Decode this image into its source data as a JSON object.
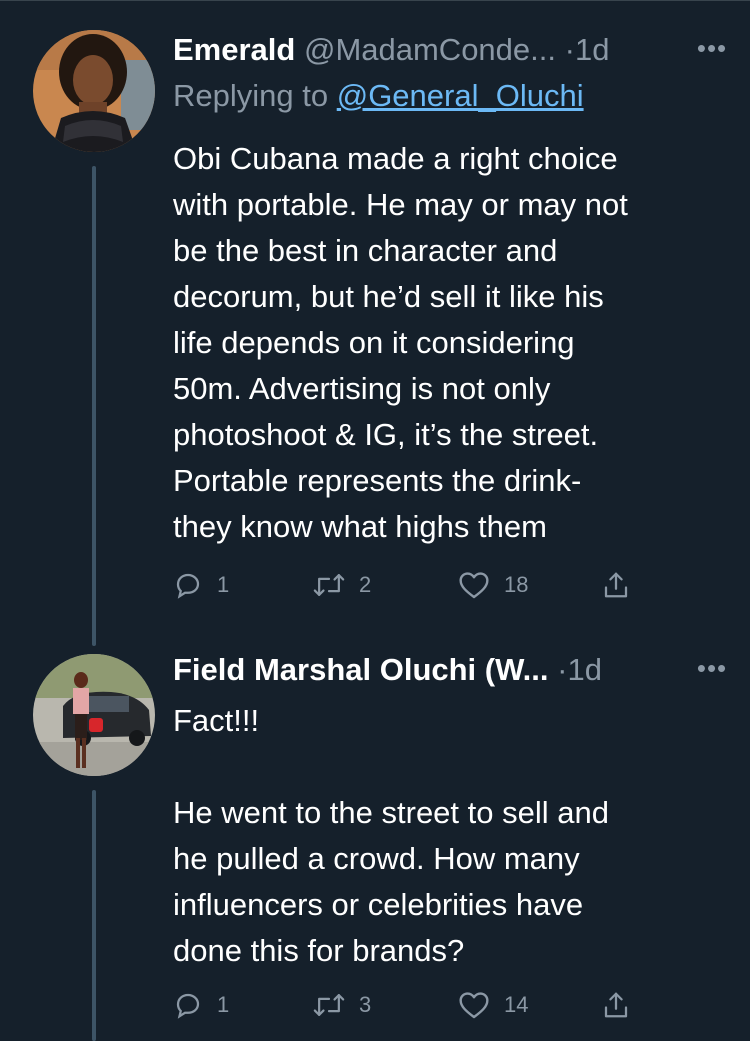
{
  "tweets": [
    {
      "display_name": "Emerald",
      "handle": "@MadamConde...",
      "dot": "·",
      "time": "1d",
      "more": "•••",
      "replying_prefix": "Replying to ",
      "replying_to": "@General_Oluchi",
      "text": "Obi Cubana made a right choice\nwith portable. He may or may not\nbe the best in character and\ndecorum, but he’d sell it like his\nlife depends on it considering\n50m. Advertising is not only\nphotoshoot & IG, it’s the street.\nPortable represents the drink-\nthey know what highs them",
      "replies": "1",
      "retweets": "2",
      "likes": "18"
    },
    {
      "display_name": "Field Marshal Oluchi (W...",
      "dot": "·",
      "time": "1d",
      "more": "•••",
      "text": "Fact!!!\n\nHe went to the street to sell and\nhe pulled a crowd. How many\ninfluencers or celebrities have\ndone this for brands?",
      "replies": "1",
      "retweets": "3",
      "likes": "14"
    }
  ],
  "icons": {
    "reply": "reply-icon",
    "retweet": "retweet-icon",
    "like": "heart-icon",
    "share": "share-icon",
    "more": "more-icon"
  },
  "colors": {
    "background": "#15202b",
    "text": "#ffffff",
    "muted": "#8b98a5",
    "link": "#6cb9f5",
    "thread_line": "#3d5466"
  }
}
